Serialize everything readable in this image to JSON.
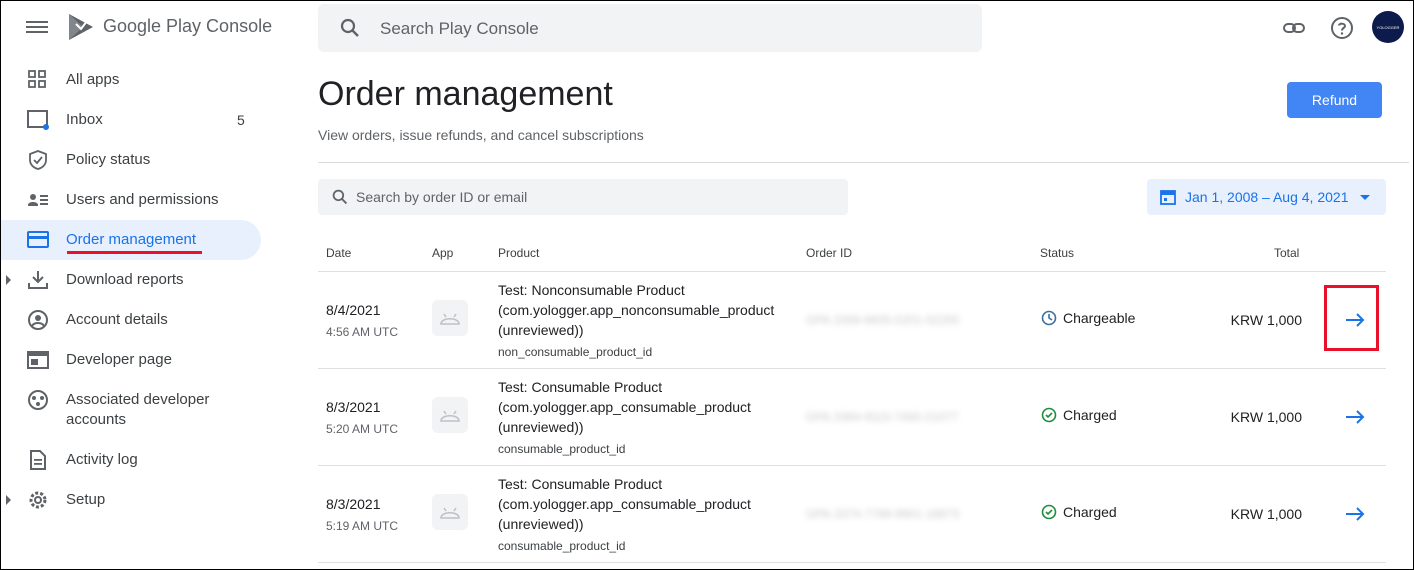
{
  "header": {
    "app_name": "Google Play Console",
    "search_placeholder": "Search Play Console",
    "avatar_text": "YOLOGGER"
  },
  "sidebar": {
    "items": [
      {
        "label": "All apps",
        "icon": "grid-icon"
      },
      {
        "label": "Inbox",
        "icon": "inbox-icon",
        "count": "5"
      },
      {
        "label": "Policy status",
        "icon": "shield-icon"
      },
      {
        "label": "Users and permissions",
        "icon": "users-icon"
      },
      {
        "label": "Order management",
        "icon": "card-icon",
        "active": true
      },
      {
        "label": "Download reports",
        "icon": "download-icon"
      },
      {
        "label": "Account details",
        "icon": "account-icon"
      },
      {
        "label": "Developer page",
        "icon": "web-page-icon"
      },
      {
        "label": "Associated developer accounts",
        "icon": "linked-accounts-icon"
      },
      {
        "label": "Activity log",
        "icon": "document-icon"
      },
      {
        "label": "Setup",
        "icon": "gear-icon"
      }
    ]
  },
  "main": {
    "title": "Order management",
    "subtitle": "View orders, issue refunds, and cancel subscriptions",
    "refund_label": "Refund",
    "order_search_placeholder": "Search by order ID or email",
    "date_range": "Jan 1, 2008 – Aug 4, 2021",
    "columns": [
      "Date",
      "App",
      "Product",
      "Order ID",
      "Status",
      "Total"
    ],
    "rows": [
      {
        "date": "8/4/2021",
        "time": "4:56 AM UTC",
        "product": "Test: Nonconsumable Product (com.yologger.app_nonconsumable_product (unreviewed))",
        "product_id": "non_consumable_product_id",
        "order_id": "GPA.3358-6605-5201-02255",
        "status": "Chargeable",
        "status_icon": "clock-icon",
        "total": "KRW 1,000"
      },
      {
        "date": "8/3/2021",
        "time": "5:20 AM UTC",
        "product": "Test: Consumable Product (com.yologger.app_consumable_product (unreviewed))",
        "product_id": "consumable_product_id",
        "order_id": "GPA.3364-9115-7450-21077",
        "status": "Charged",
        "status_icon": "check-circle-icon",
        "total": "KRW 1,000"
      },
      {
        "date": "8/3/2021",
        "time": "5:19 AM UTC",
        "product": "Test: Consumable Product (com.yologger.app_consumable_product (unreviewed))",
        "product_id": "consumable_product_id",
        "order_id": "GPA.3374-7789-9901-18873",
        "status": "Charged",
        "status_icon": "check-circle-icon",
        "total": "KRW 1,000"
      }
    ]
  },
  "colors": {
    "accent": "#1a73e8",
    "highlight": "#e8102a",
    "charged_green": "#1e8e3e"
  }
}
